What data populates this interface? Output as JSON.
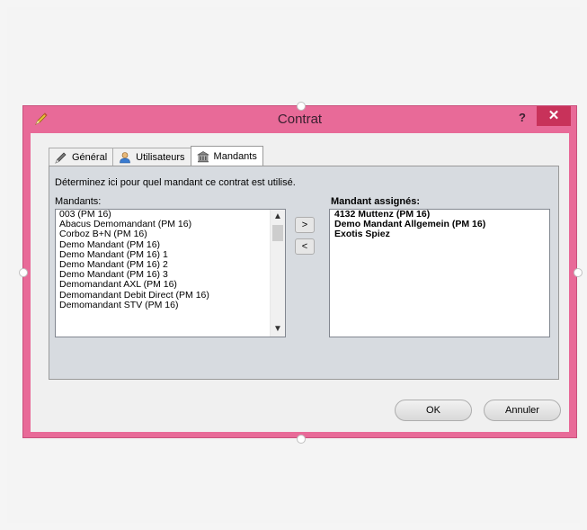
{
  "window": {
    "title": "Contrat",
    "help_label": "?",
    "close_label": "✕"
  },
  "tabs": [
    {
      "label": "Général",
      "icon": "pencil-icon",
      "active": false
    },
    {
      "label": "Utilisateurs",
      "icon": "user-icon",
      "active": false
    },
    {
      "label": "Mandants",
      "icon": "building-icon",
      "active": true
    }
  ],
  "panel": {
    "instruction": "Déterminez ici pour quel mandant ce contrat est utilisé.",
    "left_label": "Mandants:",
    "right_label": "Mandant assignés:",
    "mandants": [
      "003 (PM 16)",
      "Abacus Demomandant (PM 16)",
      "Corboz B+N (PM 16)",
      "Demo Mandant (PM 16)",
      "Demo Mandant (PM 16) 1",
      "Demo Mandant (PM 16) 2",
      "Demo Mandant (PM 16) 3",
      "Demomandant AXL (PM 16)",
      "Demomandant Debit Direct (PM 16)",
      "Demomandant STV (PM 16)"
    ],
    "assigned": [
      "4132 Muttenz (PM 16)",
      "Demo Mandant Allgemein (PM 16)",
      "Exotis Spiez"
    ],
    "add_label": ">",
    "remove_label": "<",
    "scroll_up_label": "▲",
    "scroll_down_label": "▼"
  },
  "footer": {
    "ok_label": "OK",
    "cancel_label": "Annuler"
  },
  "colors": {
    "title_bar": "#e86a98",
    "close_button": "#c8325a",
    "panel_bg": "#d7dbe0"
  }
}
